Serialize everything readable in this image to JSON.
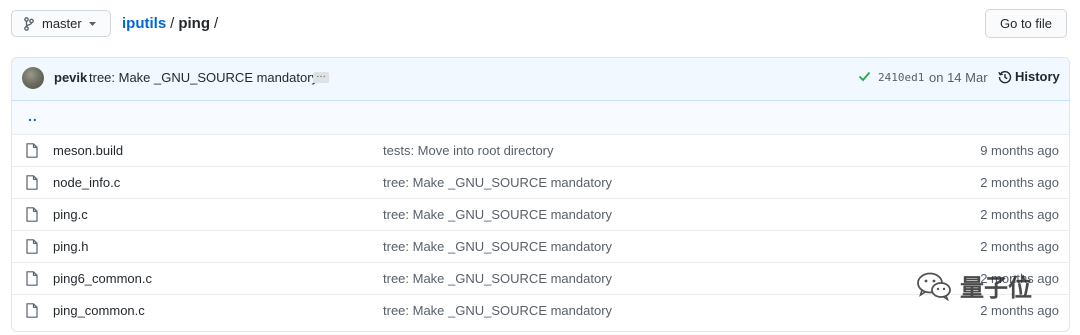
{
  "header": {
    "branch_label": "master",
    "repo_name": "iputils",
    "separator": "/",
    "directory": "ping",
    "trailing_separator": "/",
    "goto_file_label": "Go to file"
  },
  "commit": {
    "author": "pevik",
    "message": "tree: Make _GNU_SOURCE mandatory",
    "ellipsis": "…",
    "sha": "2410ed1",
    "date": "on 14 Mar",
    "history_label": "History",
    "status_color": "#28a745"
  },
  "parent_dir": "..",
  "files": [
    {
      "name": "meson.build",
      "message": "tests: Move into root directory",
      "age": "9 months ago"
    },
    {
      "name": "node_info.c",
      "message": "tree: Make _GNU_SOURCE mandatory",
      "age": "2 months ago"
    },
    {
      "name": "ping.c",
      "message": "tree: Make _GNU_SOURCE mandatory",
      "age": "2 months ago"
    },
    {
      "name": "ping.h",
      "message": "tree: Make _GNU_SOURCE mandatory",
      "age": "2 months ago"
    },
    {
      "name": "ping6_common.c",
      "message": "tree: Make _GNU_SOURCE mandatory",
      "age": "2 months ago"
    },
    {
      "name": "ping_common.c",
      "message": "tree: Make _GNU_SOURCE mandatory",
      "age": "2 months ago"
    }
  ],
  "watermark": {
    "text": "量子位",
    "icon": "wechat-icon"
  },
  "colors": {
    "link": "#0366d6",
    "commit_bar_bg": "#f1f8ff",
    "muted": "#586069"
  }
}
